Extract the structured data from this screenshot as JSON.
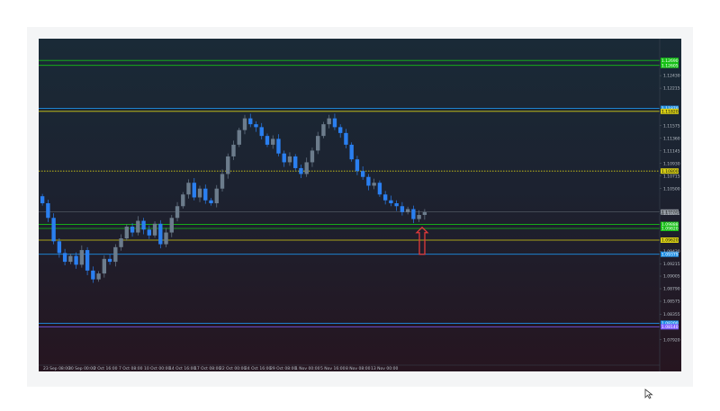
{
  "chart_data": {
    "type": "candlestick",
    "title": "",
    "xlabel": "",
    "ylabel": "",
    "ylim": [
      1.075,
      1.13
    ],
    "x_tick_labels": [
      "23 Sep 08:00",
      "30 Sep 00:00",
      "2 Oct 16:00",
      "7 Oct 08:00",
      "10 Oct 00:00",
      "14 Oct 16:00",
      "17 Oct 08:00",
      "22 Oct 00:00",
      "24 Oct 16:00",
      "29 Oct 08:00",
      "1 Nov 00:00",
      "5 Nov 16:00",
      "8 Nov 08:00",
      "13 Nov 00:00"
    ],
    "y_tick_labels": [
      "1.12430",
      "1.12215",
      "1.11575",
      "1.11360",
      "1.11145",
      "1.10930",
      "1.10715",
      "1.10500",
      "1.10075",
      "1.09430",
      "1.09215",
      "1.09005",
      "1.08790",
      "1.08575",
      "1.08355",
      "1.07920"
    ],
    "y_tick_values": [
      1.1243,
      1.12215,
      1.11575,
      1.1136,
      1.11145,
      1.1093,
      1.10715,
      1.105,
      1.10075,
      1.0943,
      1.09215,
      1.09005,
      1.0879,
      1.08575,
      1.08355,
      1.0792
    ],
    "close_series": [
      1.1025,
      1.1,
      1.096,
      1.094,
      1.0925,
      1.0935,
      1.092,
      1.0945,
      1.091,
      1.0895,
      1.0905,
      1.093,
      1.0925,
      1.095,
      1.0965,
      1.0985,
      1.0975,
      1.0995,
      1.098,
      1.097,
      1.099,
      1.0955,
      1.0975,
      1.1,
      1.102,
      1.104,
      1.106,
      1.1035,
      1.105,
      1.103,
      1.1025,
      1.105,
      1.1075,
      1.1105,
      1.1125,
      1.115,
      1.117,
      1.116,
      1.1155,
      1.114,
      1.1125,
      1.1135,
      1.111,
      1.1095,
      1.1105,
      1.1085,
      1.1075,
      1.1095,
      1.1115,
      1.114,
      1.116,
      1.117,
      1.1155,
      1.1145,
      1.1125,
      1.11,
      1.108,
      1.107,
      1.1055,
      1.106,
      1.104,
      1.103,
      1.1025,
      1.102,
      1.101,
      1.1015,
      1.0998,
      1.1005,
      1.101
    ],
    "horizontal_levels": [
      {
        "value": 1.1269,
        "label": "1.12690",
        "color": "#16c016",
        "style": "solid"
      },
      {
        "value": 1.12605,
        "label": "1.12605",
        "color": "#16c016",
        "style": "solid"
      },
      {
        "value": 1.1187,
        "label": "1.11870",
        "color": "#1e8fe6",
        "style": "solid"
      },
      {
        "value": 1.1182,
        "label": "1.11820",
        "color": "#d8cf14",
        "style": "solid"
      },
      {
        "value": 1.108,
        "label": "1.10800",
        "color": "#d8cf14",
        "style": "dotted"
      },
      {
        "value": 1.09888,
        "label": "1.09888",
        "color": "#16c016",
        "style": "solid"
      },
      {
        "value": 1.0982,
        "label": "1.09820",
        "color": "#16c016",
        "style": "solid"
      },
      {
        "value": 1.0962,
        "label": "1.09620",
        "color": "#d8cf14",
        "style": "solid"
      },
      {
        "value": 1.09379,
        "label": "1.09379",
        "color": "#1e8fe6",
        "style": "solid"
      },
      {
        "value": 1.082,
        "label": "1.08200",
        "color": "#1e8fe6",
        "style": "solid"
      },
      {
        "value": 1.0814,
        "label": "1.08140",
        "color": "#7c5cff",
        "style": "solid"
      }
    ],
    "current_price": {
      "value": 1.101,
      "label": "1.10100"
    },
    "annotation": {
      "type": "arrow-up",
      "color": "#e23a3a"
    },
    "grid": false,
    "colors": {
      "bull": "#6c7c8c",
      "bear": "#2a7ff0",
      "axis_text": "#b9c0c8"
    }
  }
}
